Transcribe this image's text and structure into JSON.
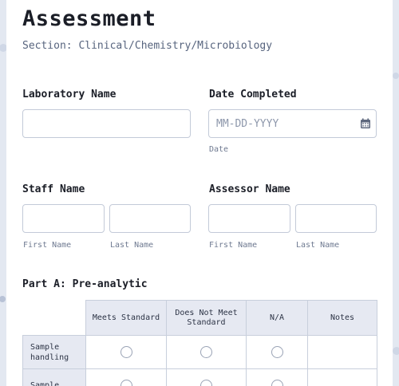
{
  "form": {
    "title": "Assessment",
    "subtitle": "Section: Clinical/Chemistry/Microbiology"
  },
  "fields": {
    "laboratory_name": {
      "label": "Laboratory Name",
      "value": ""
    },
    "date_completed": {
      "label": "Date Completed",
      "placeholder": "MM-DD-YYYY",
      "sublabel": "Date",
      "icon": "calendar-icon"
    },
    "staff_name": {
      "label": "Staff Name",
      "first_sublabel": "First Name",
      "last_sublabel": "Last Name"
    },
    "assessor_name": {
      "label": "Assessor Name",
      "first_sublabel": "First Name",
      "last_sublabel": "Last Name"
    }
  },
  "part_a": {
    "title": "Part A: Pre-analytic",
    "columns": [
      "Meets Standard",
      "Does Not Meet Standard",
      "N/A",
      "Notes"
    ],
    "rows": [
      "Sample handling",
      "Sample"
    ]
  },
  "colors": {
    "accent": "#e6e9f2",
    "border": "#c3cad8",
    "text": "#2c3345"
  }
}
